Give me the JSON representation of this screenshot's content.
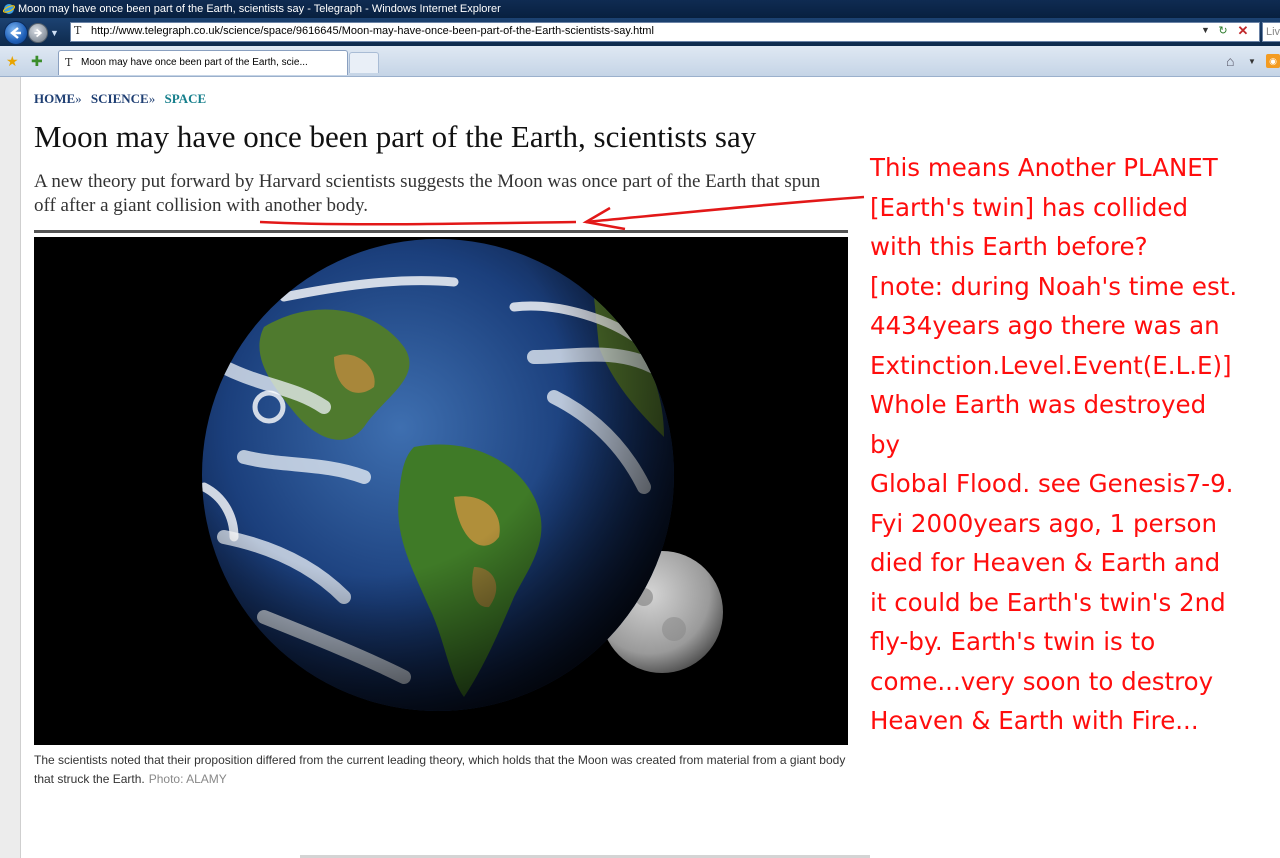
{
  "window": {
    "title": "Moon may have once been part of the Earth, scientists say - Telegraph - Windows Internet Explorer"
  },
  "address_bar": {
    "url": "http://www.telegraph.co.uk/science/space/9616645/Moon-may-have-once-been-part-of-the-Earth-scientists-say.html",
    "search_placeholder": "Liv"
  },
  "tabs": [
    {
      "label": "Moon may have once been part of the Earth, scie..."
    }
  ],
  "article": {
    "breadcrumb": [
      "HOME",
      "SCIENCE",
      "SPACE"
    ],
    "breadcrumb_separator": "»",
    "headline": "Moon may have once been part of the Earth, scientists say",
    "standfirst": "A new theory put forward by Harvard scientists suggests the Moon was once part of the Earth that spun off after a giant collision with another body.",
    "caption": "The scientists noted that their proposition differed from the current leading theory, which holds that the Moon was created from material from a giant body that struck the Earth.",
    "photo_credit": "Photo: ALAMY"
  },
  "annotation": {
    "color": "#ff0d0d",
    "lines": [
      "This means Another PLANET",
      "[Earth's twin] has collided",
      "with this Earth before?",
      "[note: during Noah's time est.",
      "4434years ago there was an",
      "Extinction.Level.Event(E.L.E)]",
      "Whole Earth was destroyed",
      "by",
      "Global Flood. see Genesis7-9.",
      "Fyi 2000years ago, 1 person",
      "died for Heaven & Earth and",
      "it could be Earth's twin's 2nd",
      "fly-by.  Earth's twin is to",
      "come...very soon to destroy",
      "Heaven & Earth with Fire..."
    ]
  },
  "icons": {
    "back": "back-arrow-icon",
    "forward": "forward-arrow-icon",
    "favorites": "favorites-star-icon",
    "add_favorites": "add-favorites-icon",
    "home": "home-icon",
    "rss": "rss-feed-icon",
    "refresh": "refresh-icon",
    "stop": "stop-icon"
  }
}
